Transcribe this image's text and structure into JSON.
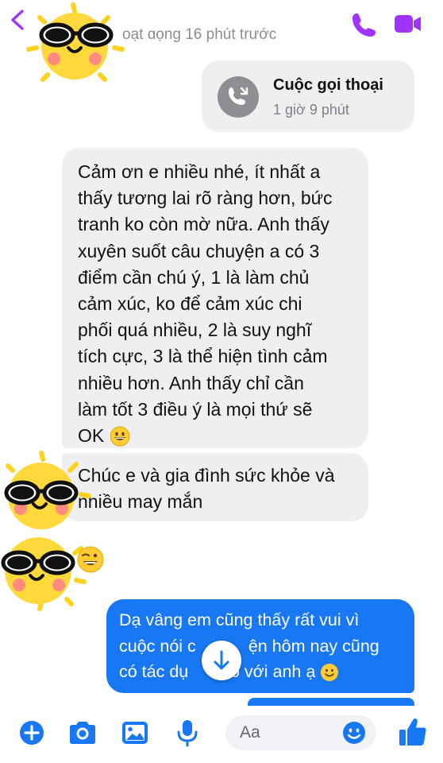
{
  "header": {
    "status_text": "oạt ɑọng 16 phút trước",
    "accent_color": "#a033ff",
    "icons": [
      "chevron-left-icon",
      "phone-icon",
      "video-camera-icon"
    ]
  },
  "call_card": {
    "title": "Cuộc gọi thoại",
    "duration": "1 giờ 9 phút",
    "icon": "phone-call-icon"
  },
  "messages": [
    {
      "direction": "incoming",
      "lines": [
        "Cảm ơn e nhiều nhé, ít nhất a",
        "thấy tương lai rõ ràng hơn, bức",
        "tranh ko còn mờ nữa. Anh thấy",
        "xuyên suốt câu chuyện a có 3",
        "điểm cần chú ý, 1 là làm chủ",
        "cảm xúc, ko để cảm xúc chi",
        "phối quá nhiều, 2 là suy nghĩ",
        "tích cực, 3 là thể hiện tình cảm",
        "nhiều hơn. Anh thấy chỉ cần",
        "làm tốt 3 điều ý là mọi thứ sẽ",
        "OK"
      ],
      "trailing_emoji": "grinning-face-emoji"
    },
    {
      "direction": "incoming",
      "lines": [
        "Chúc e và gia đình sức khỏe và",
        "nhiều may mắn"
      ]
    },
    {
      "direction": "outgoing",
      "lines": [
        "Dạ vâng em cũng thấy rất vui vì",
        "cuộc nói c",
        "ện hôm nay cũng",
        "có tác dụ",
        "i đó với anh ạ"
      ],
      "trailing_emoji": "smiling-face-emoji",
      "bubble_color": "#1877f2"
    }
  ],
  "stickers": [
    "sunglasses-sun-sticker",
    "sunglasses-sun-sticker",
    "sunglasses-sun-sticker",
    "winking-face-emoji"
  ],
  "scroll_button_icon": "arrow-down-icon",
  "composer": {
    "placeholder": "Aa",
    "icons": [
      "plus-icon",
      "camera-icon",
      "image-icon",
      "microphone-icon",
      "emoji-icon",
      "thumbs-up-icon"
    ],
    "icon_color": "#1877f2"
  }
}
